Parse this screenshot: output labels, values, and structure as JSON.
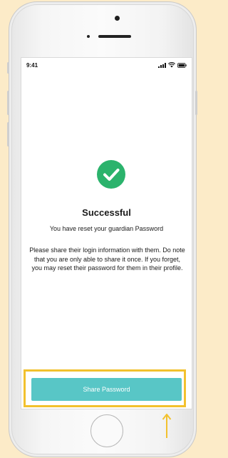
{
  "status_bar": {
    "time": "9:41"
  },
  "content": {
    "title": "Successful",
    "subtitle": "You have reset your guardian Password",
    "body": "Please share their login information with them. Do note that you are only able to share it once.  If you forget, you may reset their password for them in their profile."
  },
  "actions": {
    "share_label": "Share Password"
  },
  "icons": {
    "success": "check-circle-icon",
    "annotation": "arrow-up-icon"
  },
  "colors": {
    "background": "#fcebc8",
    "success": "#2bb36c",
    "button": "#58c6c6",
    "highlight": "#f2c12e"
  }
}
